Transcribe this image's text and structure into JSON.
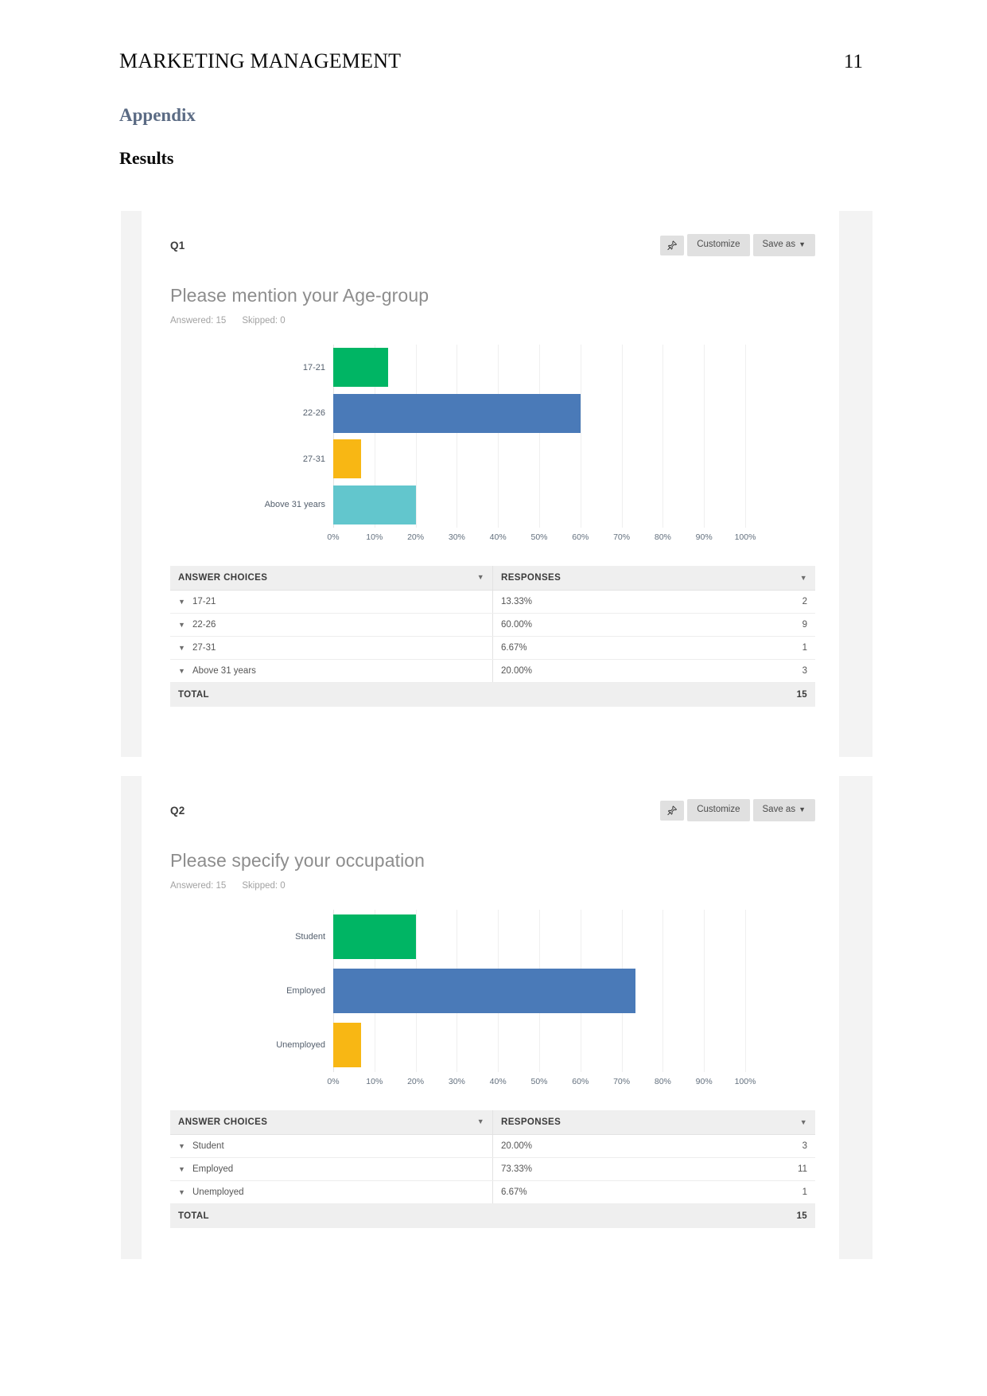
{
  "document": {
    "running_head": "MARKETING MANAGEMENT",
    "page_number": "11",
    "heading_appendix": "Appendix",
    "heading_results": "Results"
  },
  "colors": {
    "series_green": "#00b564",
    "series_blue": "#4a7ab8",
    "series_yellow": "#f8b714",
    "series_teal": "#62c6cd",
    "appendix_heading": "#5b6b84",
    "card_chrome": "#f3f3f3",
    "button_grey": "#e0e0e0"
  },
  "cards": [
    {
      "question_number": "Q1",
      "pin_icon": "pin-icon",
      "customize_label": "Customize",
      "save_as_label": "Save as",
      "save_as_caret": "▼",
      "title": "Please mention your Age-group",
      "answered_label": "Answered: 15",
      "skipped_label": "Skipped: 0",
      "table": {
        "header_choices": "ANSWER CHOICES",
        "header_responses": "RESPONSES",
        "rows": [
          {
            "choice": "17-21",
            "percent": "13.33%",
            "count": "2"
          },
          {
            "choice": "22-26",
            "percent": "60.00%",
            "count": "9"
          },
          {
            "choice": "27-31",
            "percent": "6.67%",
            "count": "1"
          },
          {
            "choice": "Above 31 years",
            "percent": "20.00%",
            "count": "3"
          }
        ],
        "total_label": "TOTAL",
        "total_value": "15"
      }
    },
    {
      "question_number": "Q2",
      "pin_icon": "pin-icon",
      "customize_label": "Customize",
      "save_as_label": "Save as",
      "save_as_caret": "▼",
      "title": "Please specify your occupation",
      "answered_label": "Answered: 15",
      "skipped_label": "Skipped: 0",
      "table": {
        "header_choices": "ANSWER CHOICES",
        "header_responses": "RESPONSES",
        "rows": [
          {
            "choice": "Student",
            "percent": "20.00%",
            "count": "3"
          },
          {
            "choice": "Employed",
            "percent": "73.33%",
            "count": "11"
          },
          {
            "choice": "Unemployed",
            "percent": "6.67%",
            "count": "1"
          }
        ],
        "total_label": "TOTAL",
        "total_value": "15"
      }
    }
  ],
  "chart_data": [
    {
      "type": "bar",
      "orientation": "horizontal",
      "title": "Please mention your Age-group",
      "categories": [
        "17-21",
        "22-26",
        "27-31",
        "Above 31 years"
      ],
      "values": [
        13.33,
        60.0,
        6.67,
        20.0
      ],
      "counts": [
        2,
        9,
        1,
        3
      ],
      "bar_colors": [
        "#00b564",
        "#4a7ab8",
        "#f8b714",
        "#62c6cd"
      ],
      "xlabel": "",
      "ylabel": "",
      "xlim": [
        0,
        100
      ],
      "xticks": [
        0,
        10,
        20,
        30,
        40,
        50,
        60,
        70,
        80,
        90,
        100
      ],
      "xtick_labels": [
        "0%",
        "10%",
        "20%",
        "30%",
        "40%",
        "50%",
        "60%",
        "70%",
        "80%",
        "90%",
        "100%"
      ],
      "grid": true,
      "legend": "none"
    },
    {
      "type": "bar",
      "orientation": "horizontal",
      "title": "Please specify your occupation",
      "categories": [
        "Student",
        "Employed",
        "Unemployed"
      ],
      "values": [
        20.0,
        73.33,
        6.67
      ],
      "counts": [
        3,
        11,
        1
      ],
      "bar_colors": [
        "#00b564",
        "#4a7ab8",
        "#f8b714"
      ],
      "xlabel": "",
      "ylabel": "",
      "xlim": [
        0,
        100
      ],
      "xticks": [
        0,
        10,
        20,
        30,
        40,
        50,
        60,
        70,
        80,
        90,
        100
      ],
      "xtick_labels": [
        "0%",
        "10%",
        "20%",
        "30%",
        "40%",
        "50%",
        "60%",
        "70%",
        "80%",
        "90%",
        "100%"
      ],
      "grid": true,
      "legend": "none"
    }
  ]
}
